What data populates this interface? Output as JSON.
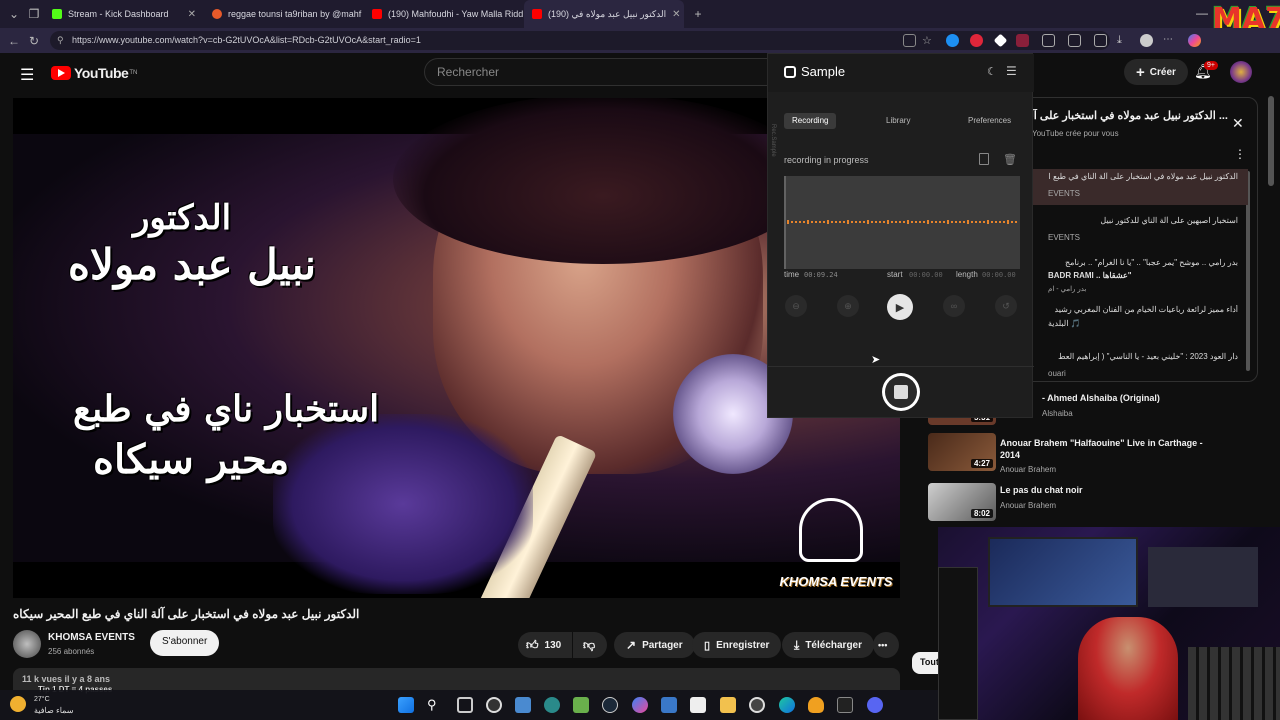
{
  "browser": {
    "tabs": [
      {
        "label": "Stream - Kick Dashboard",
        "color": "#53fc18"
      },
      {
        "label": "reggae tounsi ta9riban by @mahf",
        "color": "#e85a2a"
      },
      {
        "label": "(190) Mahfoudhi - Yaw Malla Ridd",
        "color": "#ff0000"
      },
      {
        "label": "(190) الدكتور نبيل عبد مولاه في",
        "color": "#ff0000"
      }
    ],
    "url": "https://www.youtube.com/watch?v=cb-G2tUVOcA&list=RDcb-G2tUVOcA&start_radio=1",
    "badge_text": "MA7"
  },
  "youtube": {
    "logo_text": "YouTube",
    "logo_sup": "TN",
    "search_placeholder": "Rechercher",
    "create_label": "Créer",
    "notif_badge": "9+",
    "video_title": "الدكتور نبيل عبد مولاه في استخبار على آلة الناي في طبع المحير سيكاه",
    "overlay_line1": "الدكتور",
    "overlay_line2": "نبيل عبد مولاه",
    "overlay_line3": "استخبار ناي في طبع",
    "overlay_line4": "محير سيكاه",
    "watermark_text": "KHOMSA EVENTS",
    "channel_name": "KHOMSA EVENTS",
    "subscribers": "256 abonnés",
    "subscribe_label": "S'abonner",
    "likes": "130",
    "share_label": "Partager",
    "save_label": "Enregistrer",
    "download_label": "Télécharger",
    "more_label": "•••",
    "views_line": "11 k vues  il y a 8 ans",
    "views_line2": "Tip 1 DT = 4 passes",
    "weather_temp": "27°C",
    "weather_desc": "سماء صافية",
    "all_chip": "Tout"
  },
  "sidebar": {
    "title": "... الدكتور نبيل عبد مولاه في استخبار على آلة الناي في",
    "subtitle": "YouTube crée pour vous",
    "items": [
      {
        "title": "الدكتور نبيل عبد مولاه في استخبار على آلة الناي في طبع ا",
        "channel": "EVENTS"
      },
      {
        "title": "استخبار اصبهين على آلة الناي للدكتور نبيل",
        "channel": "EVENTS"
      },
      {
        "title": "بدر رامي .. موشح \"يمر عجبا\" .. \"يا نا الغرام\" .. برنامج",
        "title2": "BADR RAMI .. عشقاها\"",
        "channel": "بدر رامي - ام"
      },
      {
        "title": "أداء مميز لرائعة رباعيات الخيام من الفنان المغربي رشيد",
        "title2": "البلدية 🎵",
        "channel": ""
      },
      {
        "title": "دار العود 2023 : \"خليني بعيد - يا الناسي\" ( إبراهيم العط",
        "channel": "ouari"
      },
      {
        "title": "- Ahmed Alshaiba (Original)",
        "channel": "Alshaiba",
        "duration": "5:31"
      },
      {
        "title": "Anouar Brahem \"Halfaouine\" Live in Carthage - 2014",
        "channel": "Anouar Brahem",
        "duration": "4:27"
      },
      {
        "title": "Le pas du chat noir",
        "channel": "Anouar Brahem",
        "duration": "8:02"
      }
    ]
  },
  "sample": {
    "app_name": "Sample",
    "tabs": [
      "Recording",
      "Library",
      "Preferences"
    ],
    "side_label": "Rec.Sample",
    "status": "recording in progress",
    "time_label": "time",
    "time_value": "00:09.24",
    "start_label": "start",
    "start_value": "00:00.00",
    "length_label": "length",
    "length_value": "00:00.00"
  }
}
